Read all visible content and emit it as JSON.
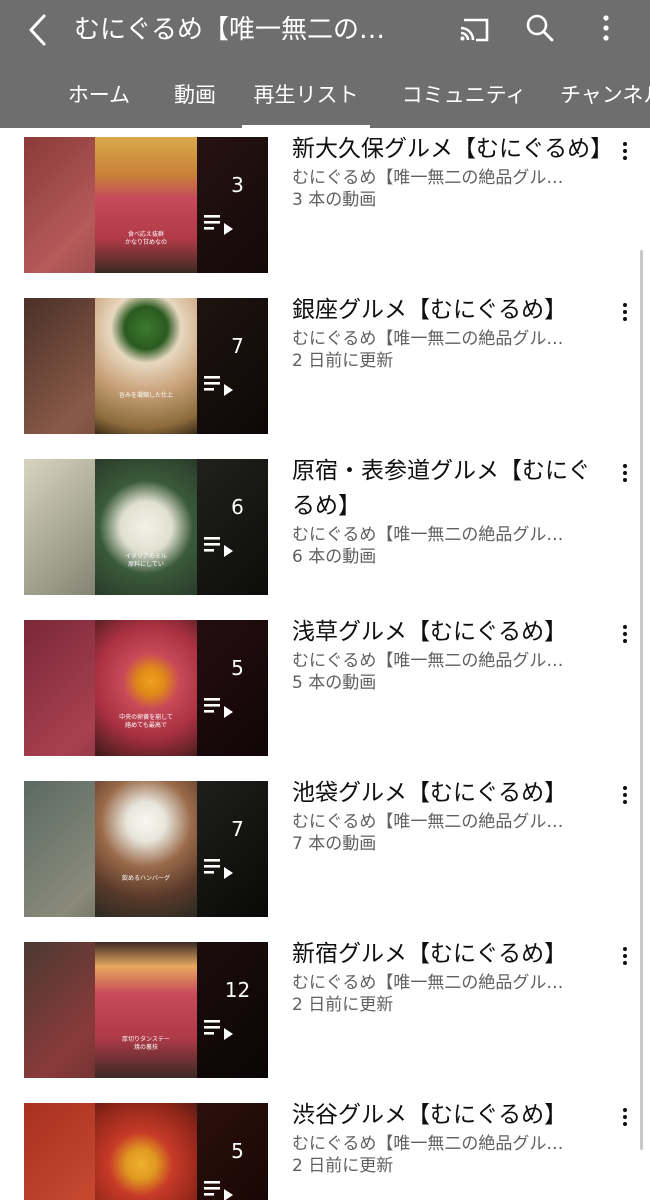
{
  "header": {
    "channel_title": "むにぐるめ【唯一無二の…",
    "icons": [
      "back-icon",
      "cast-icon",
      "search-icon",
      "more-vert-icon"
    ]
  },
  "tabs": [
    {
      "label": "ホーム",
      "active": false
    },
    {
      "label": "動画",
      "active": false
    },
    {
      "label": "再生リスト",
      "active": true
    },
    {
      "label": "コミュニティ",
      "active": false
    },
    {
      "label": "チャンネル",
      "active": false
    }
  ],
  "playlists": [
    {
      "title": "新大久保グルメ【むにぐるめ】",
      "channel": "むにぐるめ【唯一無二の絶品グル…",
      "meta": "3 本の動画",
      "count": "3",
      "caption": "食べ応え抜群\nかなり甘めなの"
    },
    {
      "title": "銀座グルメ【むにぐるめ】",
      "channel": "むにぐるめ【唯一無二の絶品グル…",
      "meta": "2 日前に更新",
      "count": "7",
      "caption": "旨みを凝縮した仕上"
    },
    {
      "title": "原宿・表参道グルメ【むにぐるめ】",
      "channel": "むにぐるめ【唯一無二の絶品グル…",
      "meta": "6 本の動画",
      "count": "6",
      "caption": "イタリアのミル\n原料にしてい"
    },
    {
      "title": "浅草グルメ【むにぐるめ】",
      "channel": "むにぐるめ【唯一無二の絶品グル…",
      "meta": "5 本の動画",
      "count": "5",
      "caption": "中央の卵黄を崩して\n絡めても最高で"
    },
    {
      "title": "池袋グルメ【むにぐるめ】",
      "channel": "むにぐるめ【唯一無二の絶品グル…",
      "meta": "7 本の動画",
      "count": "7",
      "caption": "飲めるハンバーグ"
    },
    {
      "title": "新宿グルメ【むにぐるめ】",
      "channel": "むにぐるめ【唯一無二の絶品グル…",
      "meta": "2 日前に更新",
      "count": "12",
      "caption": "厚切りタンステー\n焼の裏技"
    },
    {
      "title": "渋谷グルメ【むにぐるめ】",
      "channel": "むにぐるめ【唯一無二の絶品グル…",
      "meta": "2 日前に更新",
      "count": "5",
      "caption": ""
    }
  ],
  "colors": {
    "header_bg": "#6e6e6e",
    "title_text": "#0f0f0f",
    "secondary_text": "#606060"
  }
}
